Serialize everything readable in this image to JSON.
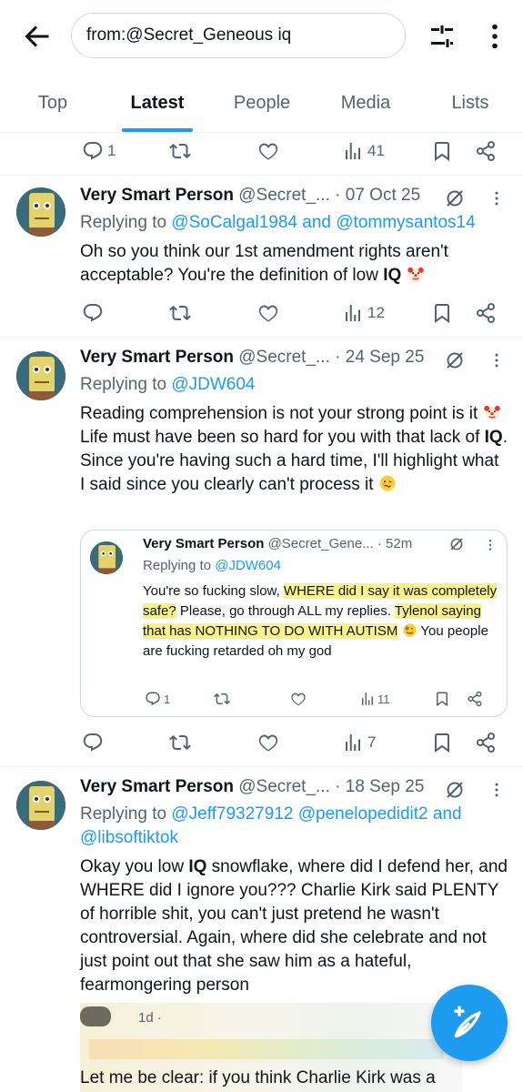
{
  "search": {
    "query": "from:@Secret_Geneous iq"
  },
  "tabs": [
    {
      "label": "Top",
      "active": false
    },
    {
      "label": "Latest",
      "active": true
    },
    {
      "label": "People",
      "active": false
    },
    {
      "label": "Media",
      "active": false
    },
    {
      "label": "Lists",
      "active": false
    }
  ],
  "top_actions": {
    "replies": "1",
    "views": "41"
  },
  "tweets": [
    {
      "name": "Very Smart Person",
      "handle_date": "@Secret_... · 07 Oct 25",
      "reply_prefix": "Replying to",
      "reply_to": "@SoCalgal1984 and @tommysantos14",
      "text_a": "Oh so you think our 1st amendment rights aren't acceptable? You're the definition of low",
      "bold": "IQ",
      "text_b": "",
      "views": "12"
    },
    {
      "name": "Very Smart Person",
      "handle_date": "@Secret_... · 24 Sep 25",
      "reply_prefix": "Replying to",
      "reply_to": "@JDW604",
      "text_a": "Reading comprehension is not your strong point is it",
      "text_b": " Life must have been so hard for you with that lack of",
      "bold": "IQ",
      "text_c": ". Since you're having such a hard time, I'll highlight what I said since you clearly can't process it",
      "views": "7",
      "quote": {
        "name": "Very Smart Person",
        "handle_time": "@Secret_Gene... · 52m",
        "reply_prefix": "Replying to",
        "reply_to": "@JDW604",
        "t1": "You're so fucking slow, ",
        "h1": "WHERE did I say it was completely safe?",
        "t2": " Please, go through ALL my replies. ",
        "h2": "Tylenol saying that has NOTHING TO DO WITH AUTISM",
        "t3": " You people are fucking retarded oh my god",
        "replies": "1",
        "views": "11"
      }
    },
    {
      "name": "Very Smart Person",
      "handle_date": "@Secret_... · 18 Sep 25",
      "reply_prefix": "Replying to",
      "reply_to_l1": "@Jeff79327912 @penelopedidit2 and",
      "reply_to_l2": "@libsoftiktok",
      "text_a": "Okay you low",
      "bold": "IQ",
      "text_b": " snowflake, where did I defend her, and WHERE did I ignore you??? Charlie Kirk said PLENTY of horrible shit, you can't just pretend he wasn't controversial. Again, where did she celebrate and not just point out that she saw him as a hateful, fearmongering person",
      "shot": {
        "time": "1d ·",
        "text": "Let me be clear: if you think Charlie Kirk was a wonderful person, we can't be friends."
      }
    }
  ],
  "colors": {
    "accent": "#1d9bf0",
    "text": "#0f1419",
    "muted": "#536471",
    "highlight": "#fbf189"
  },
  "icons": [
    "back-arrow-icon",
    "filter-icon",
    "more-vertical-icon",
    "reply-icon",
    "retweet-icon",
    "like-icon",
    "views-icon",
    "bookmark-icon",
    "share-icon",
    "grok-icon",
    "clown-emoji",
    "woozy-emoji",
    "zany-emoji",
    "compose-icon"
  ]
}
